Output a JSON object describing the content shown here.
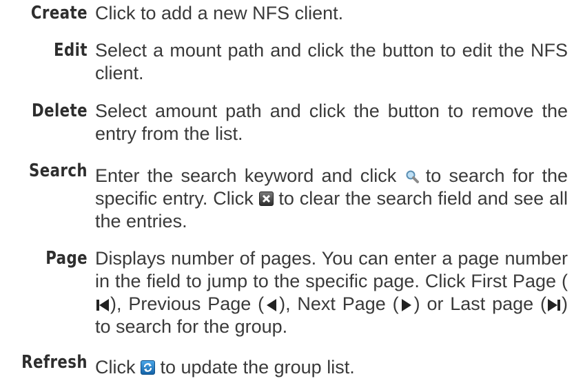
{
  "entries": [
    {
      "term": "Create",
      "parts": [
        "Click to add a new NFS client."
      ]
    },
    {
      "term": "Edit",
      "parts": [
        "Select a mount path and click the button to edit the NFS client."
      ]
    },
    {
      "term": "Delete",
      "parts": [
        "Select amount path and click the button to remove the entry from the list."
      ]
    },
    {
      "term": "Search",
      "parts": [
        "Enter the search keyword and click ",
        " to search for the specific entry. Click ",
        " to clear the search field and see all the entries."
      ]
    },
    {
      "term": "Page",
      "parts": [
        "Displays number of pages. You can enter a page number in the field to jump to the specific page. Click First Page (",
        "), Previous Page (",
        "), Next Page (",
        ") or Last page (",
        ") to search for the group."
      ]
    },
    {
      "term": "Refresh",
      "parts": [
        "Click ",
        " to update the group list."
      ]
    }
  ],
  "icons": {
    "search": "magnifier-icon",
    "clear": "clear-x-icon",
    "first_page": "first-page-icon",
    "previous_page": "previous-page-icon",
    "next_page": "next-page-icon",
    "last_page": "last-page-icon",
    "refresh": "refresh-icon"
  }
}
